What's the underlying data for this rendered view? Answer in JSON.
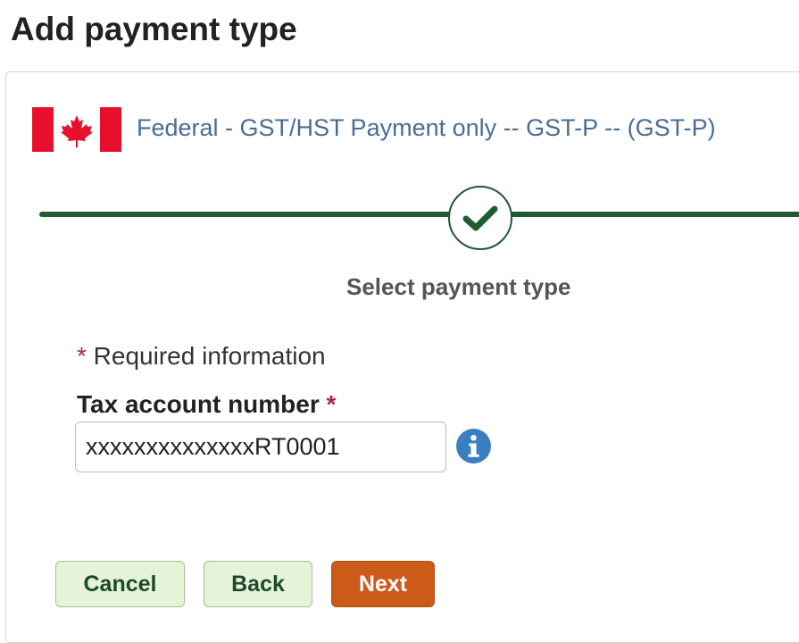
{
  "page": {
    "title": "Add payment type"
  },
  "program": {
    "title": "Federal - GST/HST Payment only -- GST-P -- (GST-P)",
    "flag_icon": "canada-flag-icon"
  },
  "stepper": {
    "current_step_label": "Select payment type",
    "step_icon": "checkmark-icon",
    "accent_color": "#1f5a30"
  },
  "form": {
    "required_note_star": "*",
    "required_note_text": " Required information",
    "tax_account": {
      "label": "Tax account number",
      "required_star": "*",
      "value": "xxxxxxxxxxxxxxRT0001",
      "info_icon": "info-icon"
    }
  },
  "actions": {
    "cancel_label": "Cancel",
    "back_label": "Back",
    "next_label": "Next",
    "primary_color": "#cc5a19",
    "secondary_color": "#e6f3d8"
  }
}
